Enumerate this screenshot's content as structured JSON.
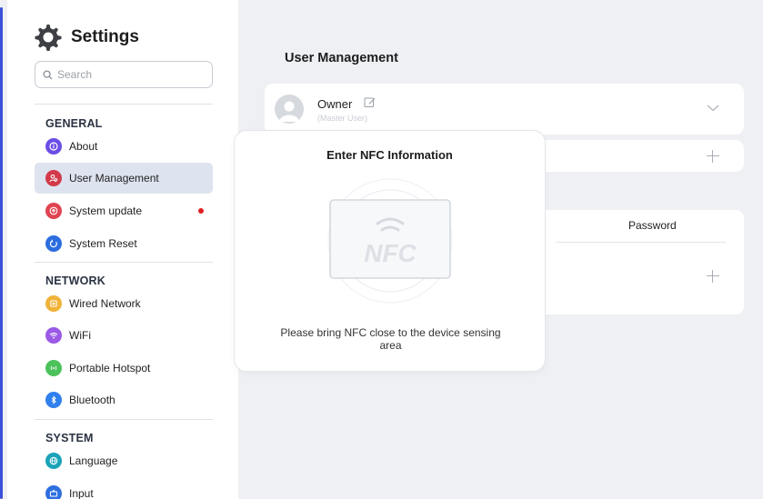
{
  "app": {
    "title": "Settings"
  },
  "search": {
    "placeholder": "Search"
  },
  "sidebar": {
    "sections": [
      {
        "label": "GENERAL"
      },
      {
        "label": "NETWORK"
      },
      {
        "label": "SYSTEM"
      }
    ],
    "items": [
      {
        "label": "About",
        "icon": "info-icon",
        "color": "#6b4de6"
      },
      {
        "label": "User Management",
        "icon": "user-icon",
        "color": "#d23a4a",
        "active": true
      },
      {
        "label": "System update",
        "icon": "update-icon",
        "color": "#e04451",
        "badge": true
      },
      {
        "label": "System Reset",
        "icon": "reset-icon",
        "color": "#2c6de0"
      },
      {
        "label": "Wired Network",
        "icon": "ethernet-icon",
        "color": "#f0b33a"
      },
      {
        "label": "WiFi",
        "icon": "wifi-icon",
        "color": "#9b5ae6"
      },
      {
        "label": "Portable Hotspot",
        "icon": "hotspot-icon",
        "color": "#4cc25a"
      },
      {
        "label": "Bluetooth",
        "icon": "bluetooth-icon",
        "color": "#2f80ed"
      },
      {
        "label": "Language",
        "icon": "globe-icon",
        "color": "#1aa3b8"
      },
      {
        "label": "Input",
        "icon": "input-icon",
        "color": "#2f6fe0"
      }
    ]
  },
  "main": {
    "title": "User Management",
    "owner": {
      "name": "Owner",
      "subtitle": "(Master User)"
    },
    "password_label": "Password"
  },
  "modal": {
    "title": "Enter NFC Information",
    "graphic_text": "NFC",
    "message": "Please bring NFC close to the device sensing area"
  }
}
